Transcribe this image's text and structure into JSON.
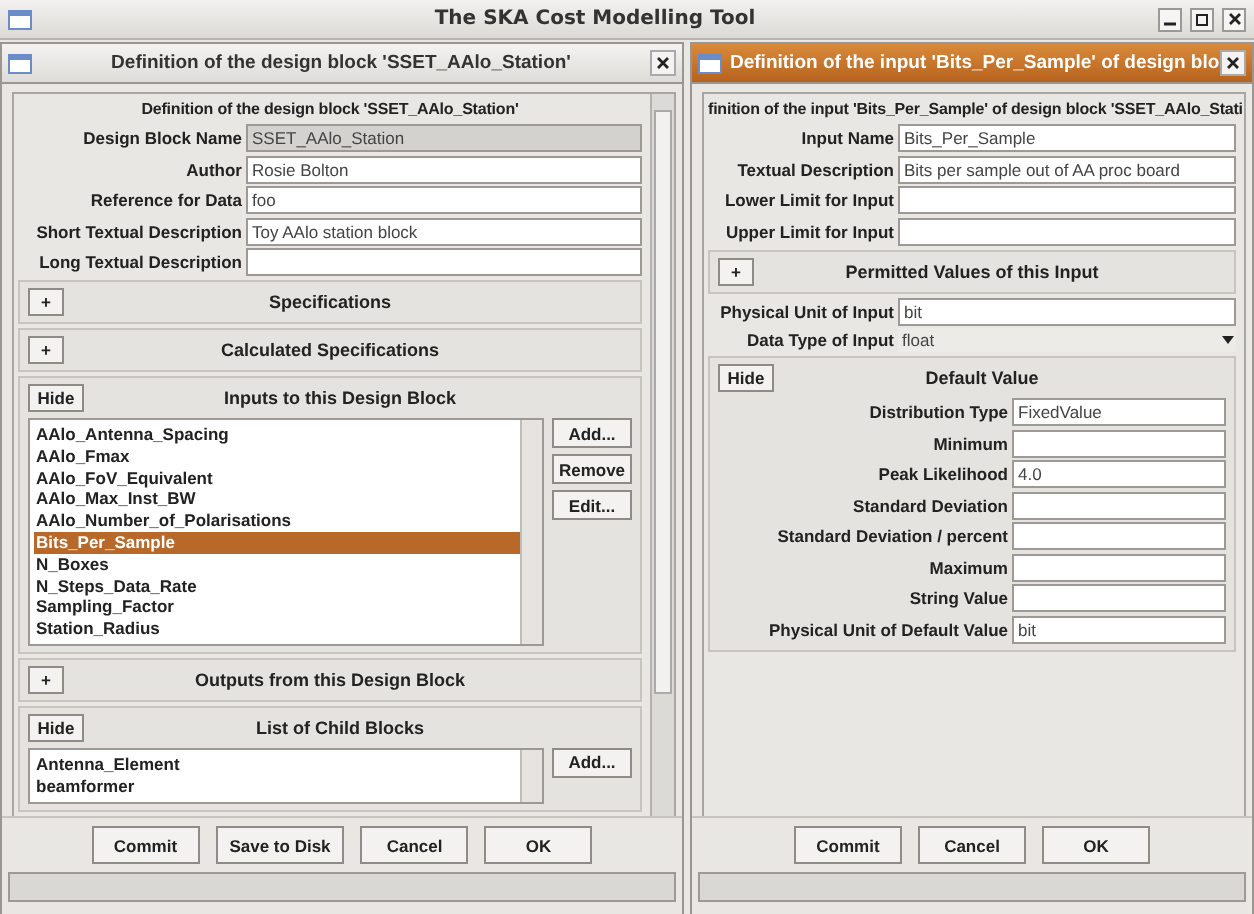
{
  "window": {
    "title": "The SKA Cost Modelling Tool"
  },
  "frames": [
    {
      "title": "Definition of the design block 'SSET_AAlo_Station'",
      "active": false,
      "heading": "Definition of the design block 'SSET_AAlo_Station'",
      "scrolls": true,
      "fields": [
        {
          "label": "Design Block Name",
          "value": "SSET_AAlo_Station",
          "disabled": true,
          "kind": "text"
        },
        {
          "label": "Author",
          "value": "Rosie Bolton",
          "disabled": false,
          "kind": "text"
        },
        {
          "label": "Reference for Data",
          "value": "foo",
          "disabled": false,
          "kind": "text"
        },
        {
          "label": "Short Textual Description",
          "value": "Toy AAlo station block",
          "disabled": false,
          "kind": "text"
        },
        {
          "label": "Long Textual Description",
          "disabled": false,
          "kind": "text"
        }
      ],
      "sections": [
        {
          "title": "Specifications",
          "toggle": "+",
          "expanded": false,
          "kind": "panel"
        },
        {
          "title": "Calculated Specifications",
          "toggle": "+",
          "expanded": false,
          "kind": "panel"
        },
        {
          "title": "Inputs to this Design Block",
          "toggle": "Hide",
          "expanded": true,
          "kind": "list",
          "items": [
            {
              "label": "AAlo_Antenna_Spacing",
              "selected": false
            },
            {
              "label": "AAlo_Fmax",
              "selected": false
            },
            {
              "label": "AAlo_FoV_Equivalent",
              "selected": false
            },
            {
              "label": "AAlo_Max_Inst_BW",
              "selected": false
            },
            {
              "label": "AAlo_Number_of_Polarisations",
              "selected": false
            },
            {
              "label": "Bits_Per_Sample",
              "selected": true
            },
            {
              "label": "N_Boxes",
              "selected": false
            },
            {
              "label": "N_Steps_Data_Rate",
              "selected": false
            },
            {
              "label": "Sampling_Factor",
              "selected": false
            },
            {
              "label": "Station_Radius",
              "selected": false
            }
          ],
          "buttons": [
            "Add...",
            "Remove",
            "Edit..."
          ]
        },
        {
          "title": "Outputs from this Design Block",
          "toggle": "+",
          "expanded": false,
          "kind": "panel"
        },
        {
          "title": "List of Child Blocks",
          "toggle": "Hide",
          "expanded": true,
          "kind": "list",
          "items": [
            {
              "label": "Antenna_Element",
              "selected": false
            },
            {
              "label": "beamformer",
              "selected": false
            }
          ],
          "buttons": [
            "Add..."
          ]
        }
      ],
      "buttons": [
        "Commit",
        "Save to Disk",
        "Cancel",
        "OK"
      ]
    },
    {
      "title": "Definition of the input 'Bits_Per_Sample' of design blo",
      "active": true,
      "heading": "finition of the input 'Bits_Per_Sample' of design block 'SSET_AAlo_Stati",
      "scrolls": false,
      "fields": [
        {
          "label": "Input Name",
          "value": "Bits_Per_Sample",
          "disabled": false,
          "kind": "text"
        },
        {
          "label": "Textual Description",
          "value": "Bits per sample out of AA proc board",
          "disabled": false,
          "kind": "text"
        },
        {
          "label": "Lower Limit for Input",
          "disabled": false,
          "kind": "text"
        },
        {
          "label": "Upper Limit for Input",
          "disabled": false,
          "kind": "text"
        }
      ],
      "sections": [
        {
          "title": "Permitted Values of this Input",
          "toggle": "+",
          "expanded": false,
          "kind": "panel"
        },
        {
          "kind": "fields",
          "fields": [
            {
              "label": "Physical Unit of Input",
              "value": "bit",
              "disabled": false,
              "kind": "text"
            },
            {
              "label": "Data Type of Input",
              "value": "float",
              "disabled": false,
              "kind": "dropdown"
            }
          ]
        },
        {
          "title": "Default Value",
          "toggle": "Hide",
          "expanded": true,
          "kind": "form",
          "fields": [
            {
              "label": "Distribution Type",
              "value": "FixedValue",
              "disabled": false,
              "kind": "text"
            },
            {
              "label": "Minimum",
              "disabled": false,
              "kind": "text"
            },
            {
              "label": "Peak Likelihood",
              "value": "4.0",
              "disabled": false,
              "kind": "text"
            },
            {
              "label": "Standard Deviation",
              "disabled": false,
              "kind": "text"
            },
            {
              "label": "Standard Deviation / percent",
              "disabled": false,
              "kind": "text"
            },
            {
              "label": "Maximum",
              "disabled": false,
              "kind": "text"
            },
            {
              "label": "String Value",
              "disabled": false,
              "kind": "text"
            },
            {
              "label": "Physical Unit of Default Value",
              "value": "bit",
              "disabled": false,
              "kind": "text"
            }
          ]
        }
      ],
      "buttons": [
        "Commit",
        "Cancel",
        "OK"
      ]
    }
  ]
}
